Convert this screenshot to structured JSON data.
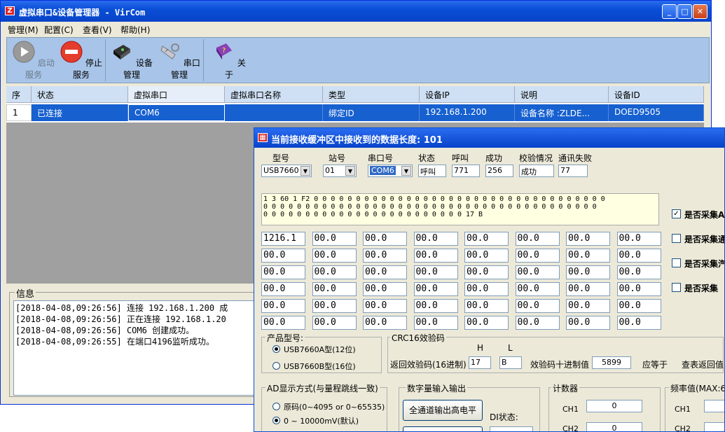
{
  "app": {
    "title": "虚拟串口&设备管理器 - VirCom",
    "icon_text": "Z"
  },
  "menu": [
    {
      "label": "管理(M)"
    },
    {
      "label": "配置(C)"
    },
    {
      "label": "查看(V)"
    },
    {
      "label": "帮助(H)"
    }
  ],
  "toolbar": {
    "start": "启动服务",
    "stop": "停止服务",
    "device": "设备管理",
    "serial": "串口管理",
    "about": "关于"
  },
  "grid": {
    "headers": [
      "序",
      "状态",
      "虚拟串口",
      "虚拟串口名称",
      "类型",
      "设备IP",
      "说明",
      "设备ID"
    ],
    "row": [
      "1",
      "已连接",
      "COM6",
      "",
      "绑定ID",
      "192.168.1.200",
      "设备名称 :ZLDE...",
      "DOED9505"
    ]
  },
  "info": {
    "label": "信息",
    "lines": [
      "[2018-04-08,09:26:56] 连接 192.168.1.200 成",
      "[2018-04-08,09:26:56] 正在连接 192.168.1.20",
      "[2018-04-08,09:26:56] COM6 创建成功。",
      "[2018-04-08,09:26:55] 在端口4196监听成功。"
    ]
  },
  "dialog": {
    "title": "当前接收缓冲区中接收到的数据长度: 101",
    "labels": {
      "model": "型号",
      "station": "站号",
      "port": "串口号",
      "status": "状态",
      "call": "呼叫",
      "success": "成功",
      "check": "校验情况",
      "fail": "通讯失败"
    },
    "values": {
      "model": "USB7660",
      "station": "01",
      "port": "COM6",
      "status": "呼叫",
      "call": "771",
      "success": "256",
      "check": "成功",
      "fail": "77"
    },
    "hex": "1 3 60 1 F2 0 0 0 0 0 0 0 0 0 0 0 0 0 0 0 0 0 0 0 0 0 0 0 0 0 0 0 0 0 0 0 0 0 0 0\n0 0 0 0 0 0 0 0 0 0 0 0 0 0 0 0 0 0 0 0 0 0 0 0 0 0 0 0 0 0 0 0 0 0 0 0 0 0 0 0\n0 0 0 0 0 0 0 0 0 0 0 0 0 0 0 0 0 0 0 0 0 0 0 0 17 B",
    "cells": [
      [
        "1216.1",
        "00.0",
        "00.0",
        "00.0",
        "00.0",
        "00.0",
        "00.0",
        "00.0"
      ],
      [
        "00.0",
        "00.0",
        "00.0",
        "00.0",
        "00.0",
        "00.0",
        "00.0",
        "00.0"
      ],
      [
        "00.0",
        "00.0",
        "00.0",
        "00.0",
        "00.0",
        "00.0",
        "00.0",
        "00.0"
      ],
      [
        "00.0",
        "00.0",
        "00.0",
        "00.0",
        "00.0",
        "00.0",
        "00.0",
        "00.0"
      ],
      [
        "00.0",
        "00.0",
        "00.0",
        "00.0",
        "00.0",
        "00.0",
        "00.0",
        "00.0"
      ],
      [
        "00.0",
        "00.0",
        "00.0",
        "00.0",
        "00.0",
        "00.0",
        "00.0",
        "00.0"
      ]
    ],
    "checks": [
      {
        "label": "是否采集A",
        "checked": true
      },
      {
        "label": "是否采集通",
        "checked": false
      },
      {
        "label": "是否采集汽",
        "checked": false
      },
      {
        "label": "是否采集",
        "checked": false
      }
    ],
    "product": {
      "label": "产品型号:",
      "opt1": "USB7660A型(12位)",
      "opt2": "USB7660B型(16位)"
    },
    "crc": {
      "label": "CRC16效验码",
      "h": "H",
      "l": "L",
      "ret_label": "返回效验码(16进制)",
      "h_val": "17",
      "l_val": "B",
      "dec_label": "效验码十进制值",
      "dec_val": "5899",
      "eq": "应等于",
      "lookup": "查表返回值"
    },
    "ad": {
      "label": "AD显示方式(与量程跳线一致)",
      "opt1": "原码(0~4095 or 0~65535)",
      "opt2": "0 ~ 10000mV(默认)"
    },
    "dio": {
      "label": "数字量输入输出",
      "btn": "全通道输出高电平",
      "di": "DI状态:"
    },
    "counter": {
      "label": "计数器",
      "ch1": "CH1",
      "ch1_val": "0",
      "ch2": "CH2",
      "ch2_val": "0"
    },
    "freq": {
      "label": "频率值(MAX:6",
      "ch1": "CH1",
      "ch2": "CH2"
    }
  }
}
